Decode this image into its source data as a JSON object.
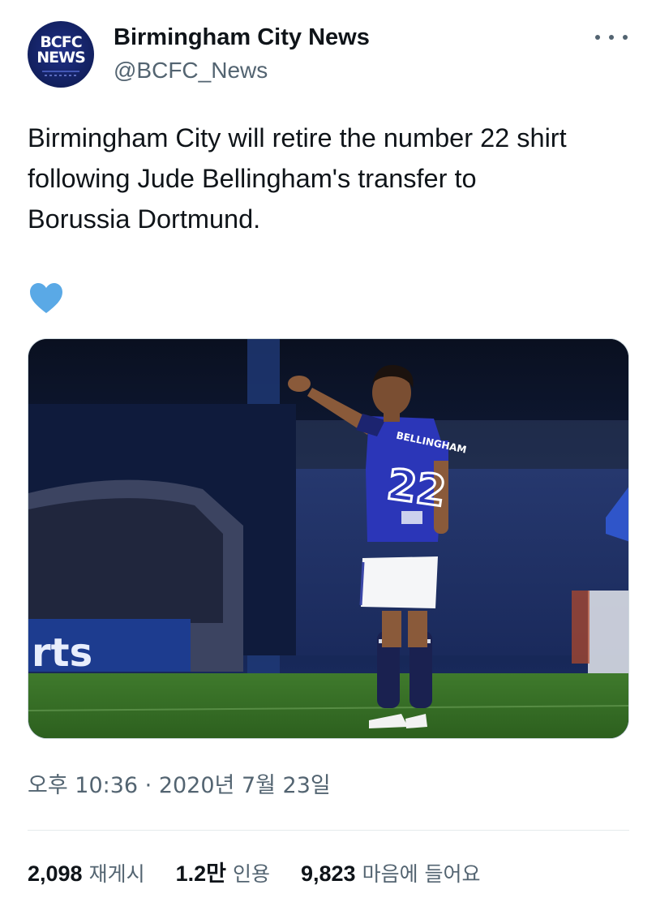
{
  "account": {
    "avatar_line1": "BCFC",
    "avatar_line2": "NEWS",
    "display_name": "Birmingham City News",
    "handle": "@BCFC_News"
  },
  "more_icon": "ellipsis-icon",
  "tweet": {
    "text": "Birmingham City will retire the number 22 shirt\nfollowing Jude Bellingham's transfer to\nBorussia Dortmund.",
    "emoji_icon": "blue-heart-icon",
    "heart_color": "#5aa9e6"
  },
  "media": {
    "image": "football-player-number-22-photo",
    "shirt_name": "BELLINGHAM",
    "shirt_number": "22",
    "board_text": "rts"
  },
  "timestamp": "오후 10:36 · 2020년 7월 23일",
  "stats": {
    "retweets": {
      "value": "2,098",
      "label": "재게시"
    },
    "quotes": {
      "value": "1.2만",
      "label": "인용"
    },
    "likes": {
      "value": "9,823",
      "label": "마음에 들어요"
    }
  },
  "colors": {
    "text_primary": "#0f1419",
    "text_secondary": "#536471",
    "divider": "#e5eaec"
  }
}
